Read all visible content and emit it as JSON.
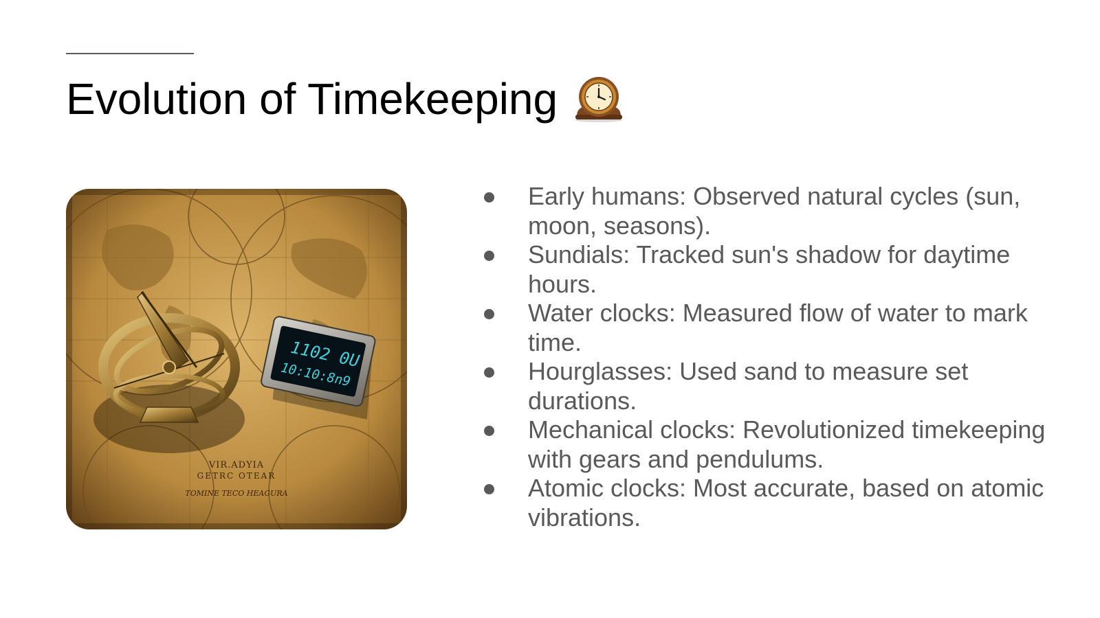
{
  "slide": {
    "title": "Evolution of Timekeeping",
    "title_icon": "mantelpiece-clock-icon",
    "image": {
      "subject": "sundial-and-digital-clock-on-antique-map",
      "clock_display": {
        "line1": "1102 0U",
        "line2": "10:10:8n9"
      },
      "map_lettering": {
        "line1": "VIR.ADYIA",
        "line2": "GETRC OTEAR",
        "line3": "TOMINE TECO HEAGURA"
      }
    },
    "bullets": [
      {
        "text": "Early humans: Observed natural cycles (sun, moon, seasons)."
      },
      {
        "text": "Sundials: Tracked sun's shadow for daytime hours."
      },
      {
        "text": "Water clocks: Measured flow of water to mark time."
      },
      {
        "text": "Hourglasses: Used sand to measure set durations."
      },
      {
        "text": "Mechanical clocks: Revolutionized timekeeping with gears and pendulums."
      },
      {
        "text": "Atomic clocks: Most accurate, based on atomic vibrations."
      }
    ]
  },
  "colors": {
    "title": "#000000",
    "body_text": "#595959",
    "accent_line": "#555a5f",
    "map_parchment": "#c8a055",
    "clock_digits": "#3fd2dc"
  }
}
